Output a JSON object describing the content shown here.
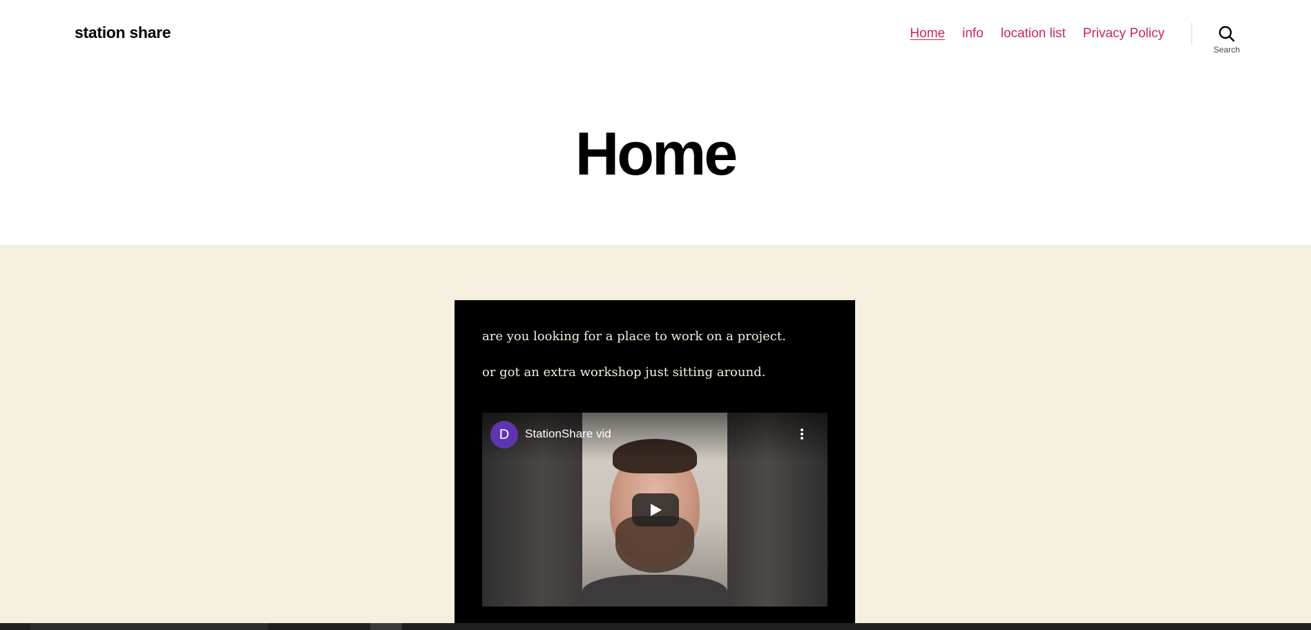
{
  "site": {
    "title": "station share"
  },
  "nav": {
    "items": [
      {
        "label": "Home",
        "current": true
      },
      {
        "label": "info",
        "current": false
      },
      {
        "label": "location list",
        "current": false
      },
      {
        "label": "Privacy Policy",
        "current": false
      }
    ],
    "search_label": "Search"
  },
  "page": {
    "title": "Home"
  },
  "content": {
    "paragraph_1": "are you looking for a place to work on a project.",
    "paragraph_2": "or got an extra workshop just sitting around."
  },
  "video": {
    "channel_initial": "D",
    "title": "StationShare vid",
    "avatar_color": "#5e35b1"
  },
  "colors": {
    "accent": "#cd2653",
    "band_background": "#f5efe0",
    "panel_background": "#000000"
  },
  "icons": {
    "search": "magnifier-icon",
    "play": "play-triangle-icon",
    "menu": "vertical-dots-icon"
  }
}
